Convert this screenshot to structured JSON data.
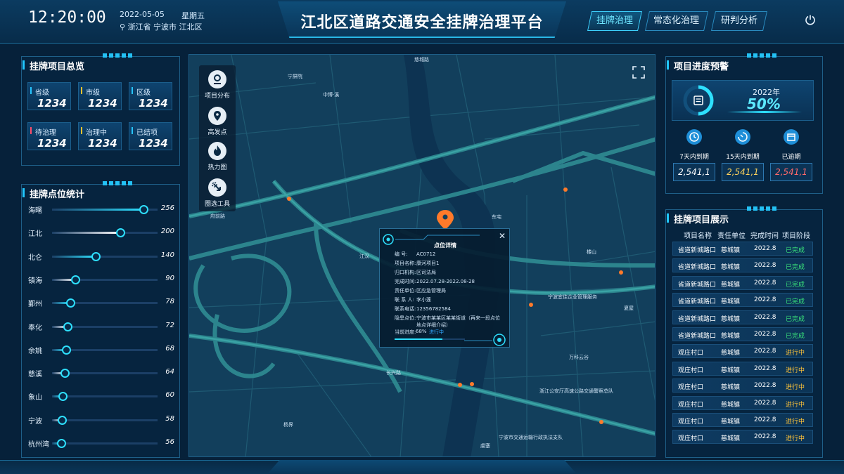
{
  "header": {
    "time": "12:20:00",
    "date": "2022-05-05",
    "weekday": "星期五",
    "location": "浙江省 宁波市 江北区",
    "title": "江北区道路交通安全挂牌治理平台",
    "tabs": [
      {
        "label": "挂牌治理",
        "active": true
      },
      {
        "label": "常态化治理",
        "active": false
      },
      {
        "label": "研判分析",
        "active": false
      }
    ],
    "power_icon": "power-icon"
  },
  "overview": {
    "title": "挂牌项目总览",
    "cards": [
      {
        "label": "省级",
        "value": "1234",
        "color": "#27c4ff"
      },
      {
        "label": "市级",
        "value": "1234",
        "color": "#f2c12e"
      },
      {
        "label": "区级",
        "value": "1234",
        "color": "#27c4ff"
      },
      {
        "label": "待治理",
        "value": "1234",
        "color": "#ff4d6a"
      },
      {
        "label": "治理中",
        "value": "1234",
        "color": "#f2c12e"
      },
      {
        "label": "已结项",
        "value": "1234",
        "color": "#27c4ff"
      }
    ]
  },
  "ranking": {
    "title": "挂牌点位统计",
    "max": 256,
    "items": [
      {
        "name": "海曙",
        "value": 256
      },
      {
        "name": "江北",
        "value": 200
      },
      {
        "name": "北仑",
        "value": 140
      },
      {
        "name": "镇海",
        "value": 90
      },
      {
        "name": "鄞州",
        "value": 78
      },
      {
        "name": "奉化",
        "value": 72
      },
      {
        "name": "余姚",
        "value": 68
      },
      {
        "name": "慈溪",
        "value": 64
      },
      {
        "name": "象山",
        "value": 60
      },
      {
        "name": "宁波",
        "value": 58
      },
      {
        "name": "杭州湾",
        "value": 56
      }
    ]
  },
  "map": {
    "tools": [
      {
        "label": "项目分布",
        "icon": "project-distribution-icon"
      },
      {
        "label": "高发点",
        "icon": "location-pin-icon"
      },
      {
        "label": "热力图",
        "icon": "flame-icon"
      },
      {
        "label": "圈选工具",
        "icon": "lasso-select-icon"
      }
    ],
    "labels": {
      "l1": "慈城路",
      "l2": "宁屏院",
      "l3": "中博·溪",
      "l4": "府前路",
      "l5": "东宅",
      "l6": "宁波宜佳企业管理服务",
      "l7": "夏屋",
      "l8": "万科云谷",
      "l9": "浙江公安厅高速公路交通警察总队",
      "l10": "宁波市交通运输行政执法支队",
      "l11": "杨界",
      "l12": "虞塞",
      "l13": "楼山",
      "l14": "江汉",
      "l15": "长兴路"
    },
    "popup": {
      "title": "点位详情",
      "rows": [
        {
          "label": "编 号:",
          "value": "AC0712"
        },
        {
          "label": "项目名称:",
          "value": "康河项目1"
        },
        {
          "label": "归口机构:",
          "value": "区司法局"
        },
        {
          "label": "完成时间:",
          "value": "2022.07.28-2022.08-28"
        },
        {
          "label": "责任单位:",
          "value": "区应急管理局"
        },
        {
          "label": "联 系 人:",
          "value": "李小莲"
        },
        {
          "label": "联系电话:",
          "value": "12356782584"
        },
        {
          "label": "隐患点位:",
          "value": "宁波市某某区某某街道（再来一段点位地点详细介绍）"
        }
      ],
      "progress_label": "当前进度:",
      "progress_value": "68%",
      "progress_status": "进行中",
      "progress_fraction": 0.68
    }
  },
  "warning": {
    "title": "项目进度预警",
    "year": "2022年",
    "percent": "50%",
    "ring_fraction": 0.5,
    "items": [
      {
        "label": "7天内到期",
        "value": "2,541,1",
        "icon": "clock-icon",
        "color": "#ffffff"
      },
      {
        "label": "15天内到期",
        "value": "2,541,1",
        "icon": "timer-icon",
        "color": "#ffd35c"
      },
      {
        "label": "已逾期",
        "value": "2,541,1",
        "icon": "calendar-icon",
        "color": "#ff6a6a"
      }
    ]
  },
  "projects": {
    "title": "挂牌项目展示",
    "headers": [
      "项目名称",
      "责任单位",
      "完成时间",
      "项目阶段"
    ],
    "rows": [
      {
        "name": "省道新城路口",
        "unit": "慈城镇",
        "time": "2022.8",
        "stage": "已完成",
        "done": true
      },
      {
        "name": "省道新城路口",
        "unit": "慈城镇",
        "time": "2022.8",
        "stage": "已完成",
        "done": true
      },
      {
        "name": "省道新城路口",
        "unit": "慈城镇",
        "time": "2022.8",
        "stage": "已完成",
        "done": true
      },
      {
        "name": "省道新城路口",
        "unit": "慈城镇",
        "time": "2022.8",
        "stage": "已完成",
        "done": true
      },
      {
        "name": "省道新城路口",
        "unit": "慈城镇",
        "time": "2022.8",
        "stage": "已完成",
        "done": true
      },
      {
        "name": "省道新城路口",
        "unit": "慈城镇",
        "time": "2022.8",
        "stage": "已完成",
        "done": true
      },
      {
        "name": "观庄村口",
        "unit": "慈城镇",
        "time": "2022.8",
        "stage": "进行中",
        "done": false
      },
      {
        "name": "观庄村口",
        "unit": "慈城镇",
        "time": "2022.8",
        "stage": "进行中",
        "done": false
      },
      {
        "name": "观庄村口",
        "unit": "慈城镇",
        "time": "2022.8",
        "stage": "进行中",
        "done": false
      },
      {
        "name": "观庄村口",
        "unit": "慈城镇",
        "time": "2022.8",
        "stage": "进行中",
        "done": false
      },
      {
        "name": "观庄村口",
        "unit": "慈城镇",
        "time": "2022.8",
        "stage": "进行中",
        "done": false
      },
      {
        "name": "观庄村口",
        "unit": "慈城镇",
        "time": "2022.8",
        "stage": "进行中",
        "done": false
      }
    ],
    "done_color": "#39e27a",
    "progress_color": "#ffc53a"
  }
}
